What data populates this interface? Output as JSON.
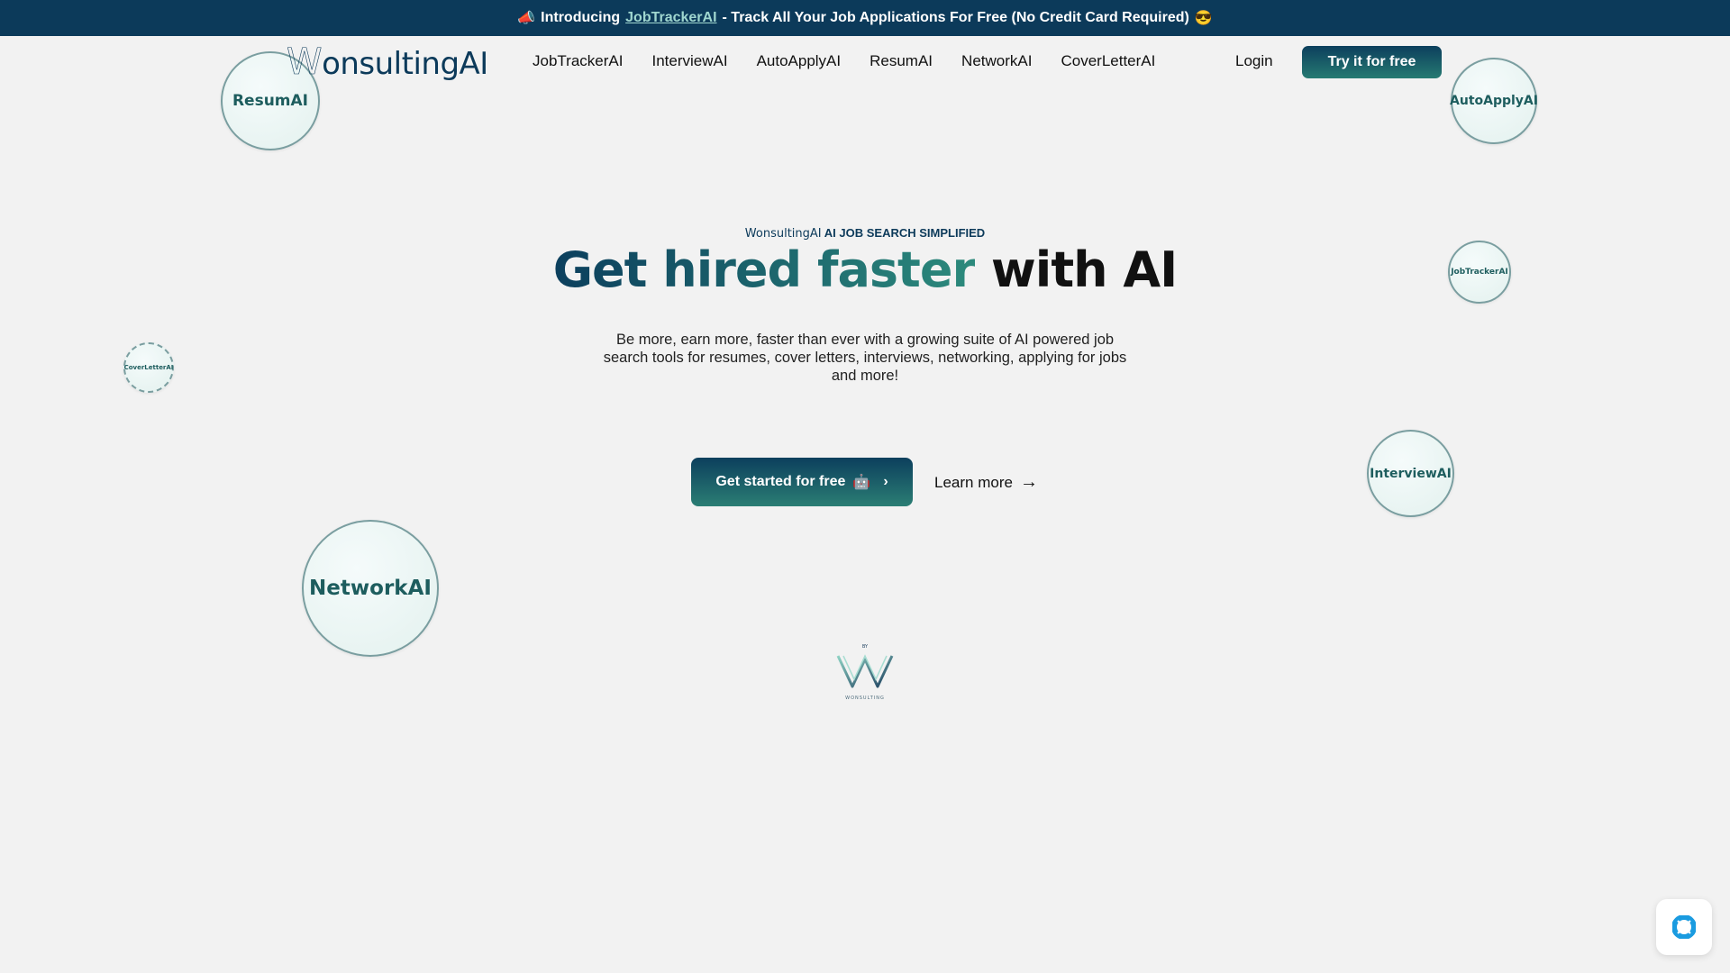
{
  "announcement": {
    "icon": "megaphone-icon",
    "prefix": "Introducing",
    "link": "JobTrackerAI",
    "suffix": "- Track All Your Job Applications For Free (No Credit Card Required)",
    "emoji": "😎"
  },
  "header": {
    "logo_w": "W",
    "logo_rest": "onsultingAI",
    "nav": [
      "JobTrackerAI",
      "InterviewAI",
      "AutoApplyAI",
      "ResumAI",
      "NetworkAI",
      "CoverLetterAI"
    ],
    "login": "Login",
    "cta": "Try it for free"
  },
  "bubbles": {
    "resum": "ResumAI",
    "autoapply": "AutoApplyAI",
    "jobtracker": "JobTrackerAI",
    "coverletter": "CoverLetterAI",
    "interview": "InterviewAI",
    "network": "NetworkAI"
  },
  "hero": {
    "eyebrow_brand": "WonsultingAI",
    "eyebrow_text": "AI JOB SEARCH SIMPLIFIED",
    "headline_1": "Get hired faster",
    "headline_2": "with AI",
    "subtitle": "Be more, earn more, faster than ever with a growing suite of AI powered job search tools for resumes, cover letters, interviews, networking, applying for jobs and more!",
    "cta_primary": "Get started for free",
    "cta_emoji": "🤖",
    "cta_chevron": "›",
    "cta_secondary": "Learn more",
    "cta_secondary_arrow": "→"
  },
  "footer_logo": {
    "by": "BY",
    "caption": "WONSULTING"
  },
  "colors": {
    "navy": "#0c3a5a",
    "teal": "#2b7e74",
    "help_blue": "#1a9be0"
  }
}
